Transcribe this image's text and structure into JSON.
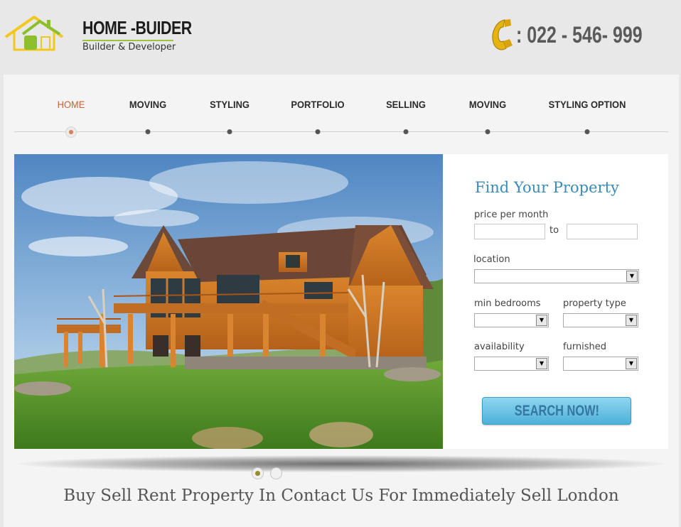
{
  "brand": {
    "title": "HOME -BUIDER",
    "subtitle": "Builder & Developer",
    "phone": ": 022 - 546- 999"
  },
  "nav": {
    "items": [
      {
        "label": "HOME",
        "active": true
      },
      {
        "label": "MOVING",
        "active": false
      },
      {
        "label": "STYLING",
        "active": false
      },
      {
        "label": "PORTFOLIO",
        "active": false
      },
      {
        "label": "SELLING",
        "active": false
      },
      {
        "label": "MOVING",
        "active": false
      },
      {
        "label": "STYLING OPTION",
        "active": false
      }
    ]
  },
  "search": {
    "title": "Find Your Property",
    "price_label": "price per month",
    "price_from": "",
    "to_label": "to",
    "price_to": "",
    "location_label": "location",
    "location_value": "",
    "min_bedrooms_label": "min bedrooms",
    "min_bedrooms_value": "",
    "property_type_label": "property type",
    "property_type_value": "",
    "availability_label": "availability",
    "availability_value": "",
    "furnished_label": "furnished",
    "furnished_value": "",
    "button_label": "SEARCH NOW!"
  },
  "slider": {
    "total": 2,
    "current": 1
  },
  "tagline": "Buy Sell Rent Property In Contact Us For Immediately Sell London",
  "colors": {
    "accent_blue": "#3a8bb5",
    "nav_active": "#c0633a",
    "logo_green": "#9cc43a",
    "logo_yellow": "#f2c81e",
    "phone_icon": "#e6b312"
  },
  "icons": {
    "logo": "house-logo-icon",
    "phone": "phone-icon",
    "select": "chevron-down-icon"
  }
}
